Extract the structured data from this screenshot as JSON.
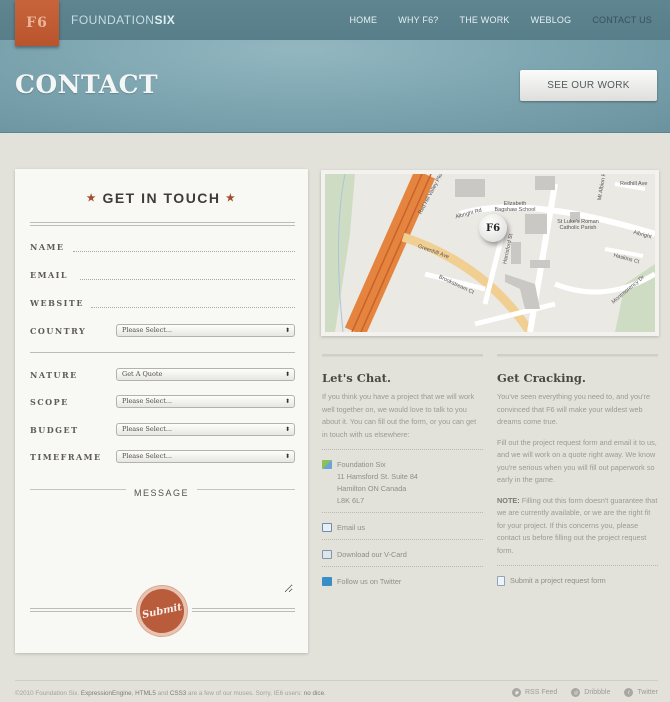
{
  "header": {
    "logo": "F6",
    "brand_light": "FOUNDATION",
    "brand_bold": "SIX",
    "nav": [
      {
        "label": "HOME",
        "active": false
      },
      {
        "label": "WHY F6?",
        "active": false
      },
      {
        "label": "THE WORK",
        "active": false
      },
      {
        "label": "WEBLOG",
        "active": false
      },
      {
        "label": "CONTACT US",
        "active": true
      }
    ],
    "page_title": "CONTACT",
    "cta_label": "SEE OUR WORK"
  },
  "form": {
    "title": "GET IN TOUCH",
    "fields": {
      "name": {
        "label": "NAME",
        "value": ""
      },
      "email": {
        "label": "EMAIL",
        "value": ""
      },
      "website": {
        "label": "WEBSITE",
        "value": ""
      },
      "country": {
        "label": "COUNTRY",
        "value": "Please Select..."
      },
      "nature": {
        "label": "NATURE",
        "value": "Get A Quote"
      },
      "scope": {
        "label": "SCOPE",
        "value": "Please Select..."
      },
      "budget": {
        "label": "BUDGET",
        "value": "Please Select..."
      },
      "timeframe": {
        "label": "TIMEFRAME",
        "value": "Please Select..."
      }
    },
    "message_label": "MESSAGE",
    "message_value": "",
    "submit_label": "Submit"
  },
  "map": {
    "pin_label": "F6",
    "labels": [
      "Red Hill Valley Pkwy",
      "Albright Rd",
      "Elizabeth Bagshaw School",
      "St Luke's Roman Catholic Parish",
      "Redhill Ave",
      "Mt Albion Rd",
      "Greenhill Ave",
      "Harrisford St",
      "Haskins Ct",
      "Brookstream Ct",
      "Montmorency Dr",
      "Albright"
    ]
  },
  "chat": {
    "title": "Let's Chat.",
    "body": "If you think you have a project that we will work well together on, we would love to talk to you about it. You can fill out the form, or you can get in touch with us elsewhere:",
    "address": {
      "name": "Foundation Six",
      "line1": "11 Hamsford St. Suite 84",
      "line2": "Hamilton ON Canada",
      "line3": "L8K 6L7"
    },
    "links": {
      "email": "Email us",
      "vcard": "Download our V-Card",
      "twitter": "Follow us on Twitter"
    }
  },
  "cracking": {
    "title": "Get Cracking.",
    "p1": "You've seen everything you need to, and you're convinced that F6 will make your wildest web dreams come true.",
    "p2": "Fill out the project request form and email it to us, and we will work on a quote right away. We know you're serious when you will fill out paperwork so early in the game.",
    "note_label": "NOTE:",
    "note_text": " Filling out this form doesn't guarantee that we are currently available, or we are the right fit for your project. If this concerns you, please contact us before filling out the project request form.",
    "link": "Submit a project request form"
  },
  "footer": {
    "t1": "©2010 Foundation Six. ",
    "ee": "ExpressionEngine",
    "t2": ", ",
    "html5": "HTML5",
    "t3": " and ",
    "css3": "CSS3",
    "t4": " are a few of our muses. Sorry, IE6 users: ",
    "nodice": "no dice",
    "t5": ".",
    "links": [
      "RSS Feed",
      "Dribbble",
      "Twitter"
    ]
  }
}
